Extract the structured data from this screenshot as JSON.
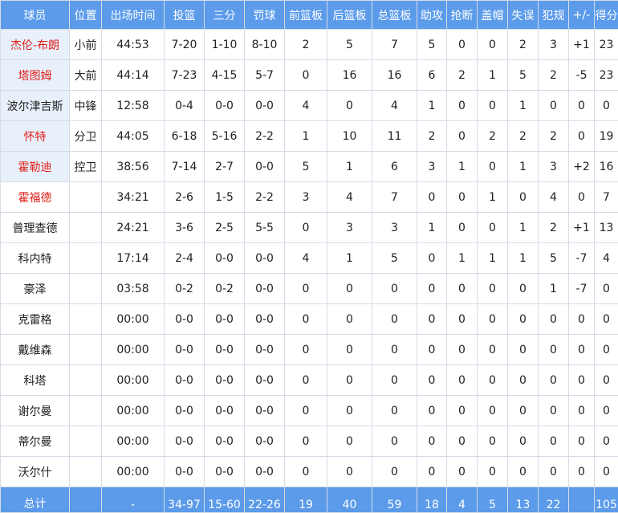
{
  "headers": [
    "球员",
    "位置",
    "出场时间",
    "投篮",
    "三分",
    "罚球",
    "前篮板",
    "后篮板",
    "总篮板",
    "助攻",
    "抢断",
    "盖帽",
    "失误",
    "犯规",
    "+/-",
    "得分"
  ],
  "rows": [
    {
      "name": "杰伦-布朗",
      "red": true,
      "pos": "小前",
      "min": "44:53",
      "fg": "7-20",
      "tp": "1-10",
      "ft": "8-10",
      "oreb": "2",
      "dreb": "5",
      "reb": "7",
      "ast": "5",
      "stl": "0",
      "blk": "0",
      "tov": "2",
      "pf": "3",
      "pm": "+1",
      "pts": "23"
    },
    {
      "name": "塔图姆",
      "red": true,
      "pos": "大前",
      "min": "44:14",
      "fg": "7-23",
      "tp": "4-15",
      "ft": "5-7",
      "oreb": "0",
      "dreb": "16",
      "reb": "16",
      "ast": "6",
      "stl": "2",
      "blk": "1",
      "tov": "5",
      "pf": "2",
      "pm": "-5",
      "pts": "23"
    },
    {
      "name": "波尔津吉斯",
      "red": false,
      "pos": "中锋",
      "min": "12:58",
      "fg": "0-4",
      "tp": "0-0",
      "ft": "0-0",
      "oreb": "4",
      "dreb": "0",
      "reb": "4",
      "ast": "1",
      "stl": "0",
      "blk": "0",
      "tov": "1",
      "pf": "0",
      "pm": "0",
      "pts": "0"
    },
    {
      "name": "怀特",
      "red": true,
      "pos": "分卫",
      "min": "44:05",
      "fg": "6-18",
      "tp": "5-16",
      "ft": "2-2",
      "oreb": "1",
      "dreb": "10",
      "reb": "11",
      "ast": "2",
      "stl": "0",
      "blk": "2",
      "tov": "2",
      "pf": "2",
      "pm": "0",
      "pts": "19"
    },
    {
      "name": "霍勒迪",
      "red": true,
      "pos": "控卫",
      "min": "38:56",
      "fg": "7-14",
      "tp": "2-7",
      "ft": "0-0",
      "oreb": "5",
      "dreb": "1",
      "reb": "6",
      "ast": "3",
      "stl": "1",
      "blk": "0",
      "tov": "1",
      "pf": "3",
      "pm": "+2",
      "pts": "16"
    },
    {
      "name": "霍福德",
      "red": true,
      "pos": "",
      "min": "34:21",
      "fg": "2-6",
      "tp": "1-5",
      "ft": "2-2",
      "oreb": "3",
      "dreb": "4",
      "reb": "7",
      "ast": "0",
      "stl": "0",
      "blk": "1",
      "tov": "0",
      "pf": "4",
      "pm": "0",
      "pts": "7"
    },
    {
      "name": "普理查德",
      "red": false,
      "pos": "",
      "min": "24:21",
      "fg": "3-6",
      "tp": "2-5",
      "ft": "5-5",
      "oreb": "0",
      "dreb": "3",
      "reb": "3",
      "ast": "1",
      "stl": "0",
      "blk": "0",
      "tov": "1",
      "pf": "2",
      "pm": "+1",
      "pts": "13"
    },
    {
      "name": "科内特",
      "red": false,
      "pos": "",
      "min": "17:14",
      "fg": "2-4",
      "tp": "0-0",
      "ft": "0-0",
      "oreb": "4",
      "dreb": "1",
      "reb": "5",
      "ast": "0",
      "stl": "1",
      "blk": "1",
      "tov": "1",
      "pf": "5",
      "pm": "-7",
      "pts": "4"
    },
    {
      "name": "豪泽",
      "red": false,
      "pos": "",
      "min": "03:58",
      "fg": "0-2",
      "tp": "0-2",
      "ft": "0-0",
      "oreb": "0",
      "dreb": "0",
      "reb": "0",
      "ast": "0",
      "stl": "0",
      "blk": "0",
      "tov": "0",
      "pf": "1",
      "pm": "-7",
      "pts": "0"
    },
    {
      "name": "克雷格",
      "red": false,
      "pos": "",
      "min": "00:00",
      "fg": "0-0",
      "tp": "0-0",
      "ft": "0-0",
      "oreb": "0",
      "dreb": "0",
      "reb": "0",
      "ast": "0",
      "stl": "0",
      "blk": "0",
      "tov": "0",
      "pf": "0",
      "pm": "0",
      "pts": "0"
    },
    {
      "name": "戴维森",
      "red": false,
      "pos": "",
      "min": "00:00",
      "fg": "0-0",
      "tp": "0-0",
      "ft": "0-0",
      "oreb": "0",
      "dreb": "0",
      "reb": "0",
      "ast": "0",
      "stl": "0",
      "blk": "0",
      "tov": "0",
      "pf": "0",
      "pm": "0",
      "pts": "0"
    },
    {
      "name": "科塔",
      "red": false,
      "pos": "",
      "min": "00:00",
      "fg": "0-0",
      "tp": "0-0",
      "ft": "0-0",
      "oreb": "0",
      "dreb": "0",
      "reb": "0",
      "ast": "0",
      "stl": "0",
      "blk": "0",
      "tov": "0",
      "pf": "0",
      "pm": "0",
      "pts": "0"
    },
    {
      "name": "谢尔曼",
      "red": false,
      "pos": "",
      "min": "00:00",
      "fg": "0-0",
      "tp": "0-0",
      "ft": "0-0",
      "oreb": "0",
      "dreb": "0",
      "reb": "0",
      "ast": "0",
      "stl": "0",
      "blk": "0",
      "tov": "0",
      "pf": "0",
      "pm": "0",
      "pts": "0"
    },
    {
      "name": "蒂尔曼",
      "red": false,
      "pos": "",
      "min": "00:00",
      "fg": "0-0",
      "tp": "0-0",
      "ft": "0-0",
      "oreb": "0",
      "dreb": "0",
      "reb": "0",
      "ast": "0",
      "stl": "0",
      "blk": "0",
      "tov": "0",
      "pf": "0",
      "pm": "0",
      "pts": "0"
    },
    {
      "name": "沃尔什",
      "red": false,
      "pos": "",
      "min": "00:00",
      "fg": "0-0",
      "tp": "0-0",
      "ft": "0-0",
      "oreb": "0",
      "dreb": "0",
      "reb": "0",
      "ast": "0",
      "stl": "0",
      "blk": "0",
      "tov": "0",
      "pf": "0",
      "pm": "0",
      "pts": "0"
    }
  ],
  "totals": {
    "name": "总计",
    "pos": "",
    "min": "-",
    "fg": "34-97",
    "tp": "15-60",
    "ft": "22-26",
    "oreb": "19",
    "dreb": "40",
    "reb": "59",
    "ast": "18",
    "stl": "4",
    "blk": "5",
    "tov": "13",
    "pf": "22",
    "pm": "",
    "pts": "105"
  },
  "colors": {
    "header_bg": "#5b9bea",
    "header_text": "#ffffff",
    "starter_bg": "#e8f0fb",
    "highlight_red": "#e0201a",
    "border": "#d5dbe6"
  }
}
